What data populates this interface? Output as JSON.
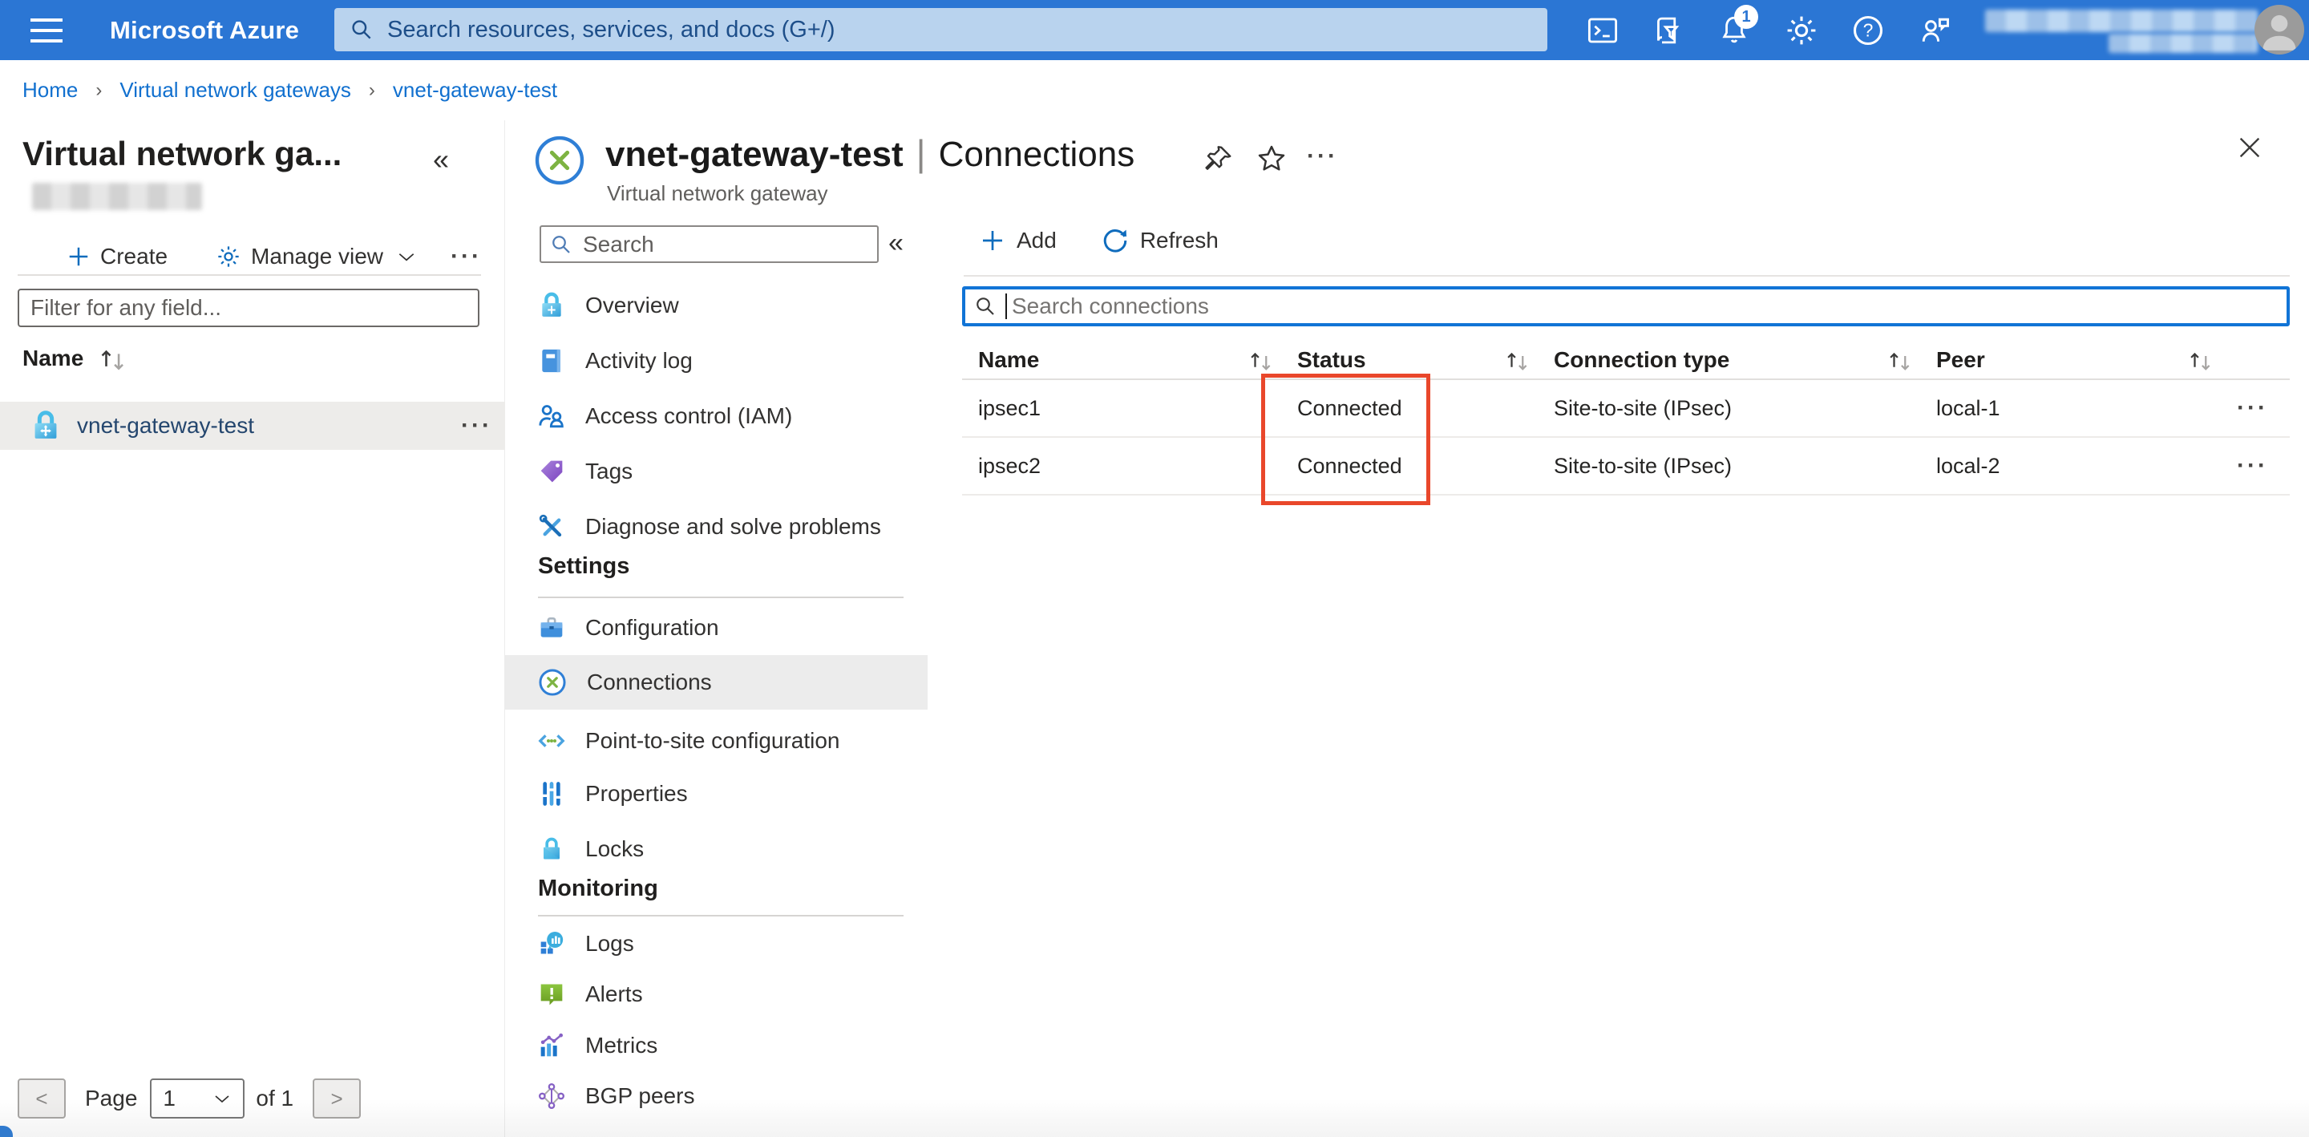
{
  "topbar": {
    "brand": "Microsoft Azure",
    "search_placeholder": "Search resources, services, and docs (G+/)",
    "notification_count": "1"
  },
  "breadcrumb": {
    "separator": "›",
    "items": [
      "Home",
      "Virtual network gateways",
      "vnet-gateway-test"
    ]
  },
  "left_panel": {
    "title": "Virtual network ga...",
    "collapse": "«",
    "toolbar": {
      "create": "Create",
      "manage_view": "Manage view",
      "more": "···"
    },
    "filter_placeholder": "Filter for any field...",
    "column_name": "Name",
    "rows": [
      {
        "name": "vnet-gateway-test",
        "more": "···"
      }
    ],
    "pagination": {
      "prev": "<",
      "page_label": "Page",
      "current_page": "1",
      "of_label": "of 1",
      "next": ">"
    }
  },
  "blade": {
    "title": "vnet-gateway-test",
    "title_separator": "|",
    "title_section": "Connections",
    "subtitle": "Virtual network gateway",
    "header_more": "···",
    "menu": {
      "search_placeholder": "Search",
      "collapse": "«",
      "items": [
        {
          "label": "Overview"
        },
        {
          "label": "Activity log"
        },
        {
          "label": "Access control (IAM)"
        },
        {
          "label": "Tags"
        },
        {
          "label": "Diagnose and solve problems"
        }
      ],
      "sections": [
        {
          "header": "Settings",
          "items": [
            {
              "label": "Configuration"
            },
            {
              "label": "Connections",
              "selected": true
            },
            {
              "label": "Point-to-site configuration"
            },
            {
              "label": "Properties"
            },
            {
              "label": "Locks"
            }
          ]
        },
        {
          "header": "Monitoring",
          "items": [
            {
              "label": "Logs"
            },
            {
              "label": "Alerts"
            },
            {
              "label": "Metrics"
            },
            {
              "label": "BGP peers"
            }
          ]
        }
      ]
    }
  },
  "content": {
    "toolbar": {
      "add": "Add",
      "refresh": "Refresh"
    },
    "search_placeholder": "Search connections",
    "table": {
      "columns": [
        "Name",
        "Status",
        "Connection type",
        "Peer"
      ],
      "rows": [
        {
          "name": "ipsec1",
          "status": "Connected",
          "type": "Site-to-site (IPsec)",
          "peer": "local-1",
          "more": "···"
        },
        {
          "name": "ipsec2",
          "status": "Connected",
          "type": "Site-to-site (IPsec)",
          "peer": "local-2",
          "more": "···"
        }
      ]
    },
    "annotation": {
      "highlight_color": "#e9472b"
    }
  }
}
